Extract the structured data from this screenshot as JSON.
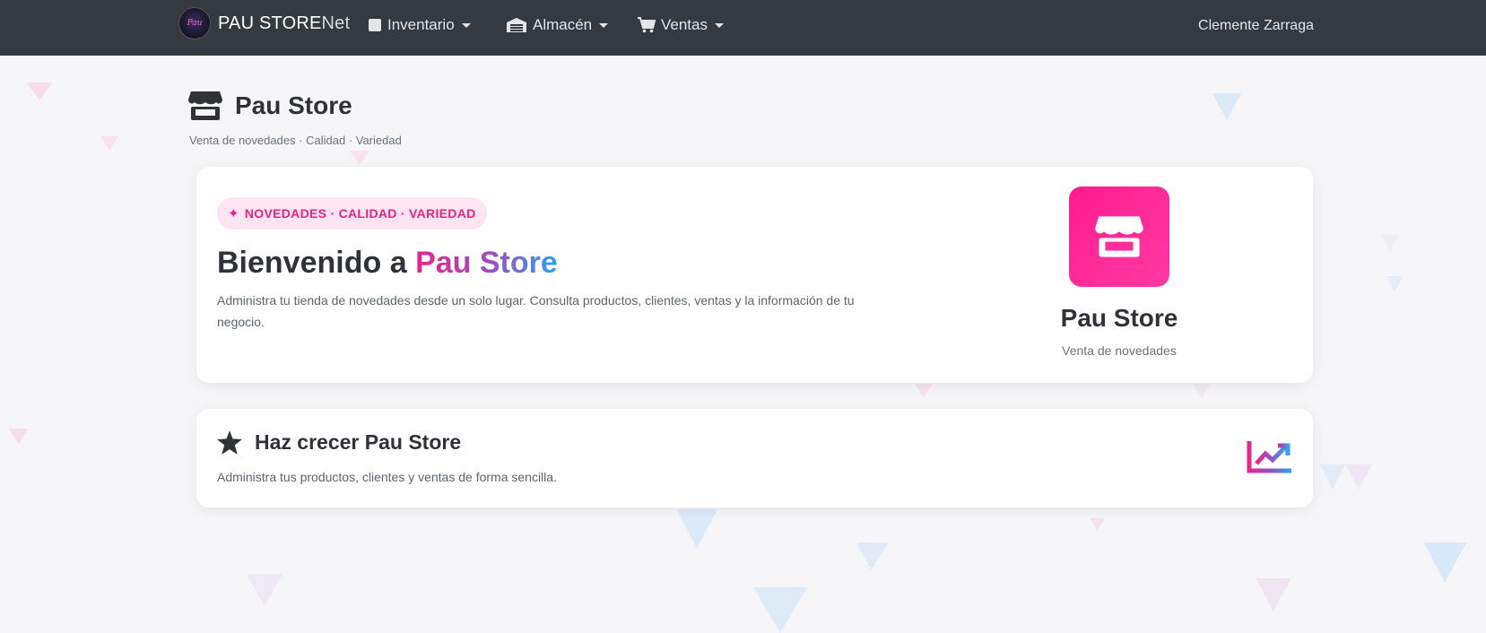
{
  "navbar": {
    "brand_logo_text": "Pau",
    "brand_bold": "PAU STORE",
    "brand_light": "Net",
    "items": [
      {
        "label": "Inventario",
        "icon": "box-icon"
      },
      {
        "label": "Almacén",
        "icon": "warehouse-icon"
      },
      {
        "label": "Ventas",
        "icon": "cart-icon"
      }
    ],
    "user": "Clemente Zarraga"
  },
  "header": {
    "icon": "store-icon",
    "title": "Pau Store",
    "subtitle": "Venta de novedades · Calidad · Variedad"
  },
  "hero": {
    "badge": "NOVEDADES · CALIDAD · VARIEDAD",
    "badge_icon": "sparkle-icon",
    "title_prefix": "Bienvenido a ",
    "title_highlight": "Pau Store",
    "description": "Administra tu tienda de novedades desde un solo lugar. Consulta productos, clientes, ventas y la información de tu negocio.",
    "store_name": "Pau Store",
    "store_tagline": "Venta de novedades"
  },
  "grow": {
    "icon": "star-icon",
    "title": "Haz crecer Pau Store",
    "description": "Administra tus productos, clientes y ventas de forma sencilla.",
    "side_icon": "trending-up-icon"
  },
  "colors": {
    "navbar": "#343a40",
    "accent_pink": "#ff1c8e",
    "accent_blue": "#2aa4ec",
    "badge_bg": "#fde4f0"
  }
}
